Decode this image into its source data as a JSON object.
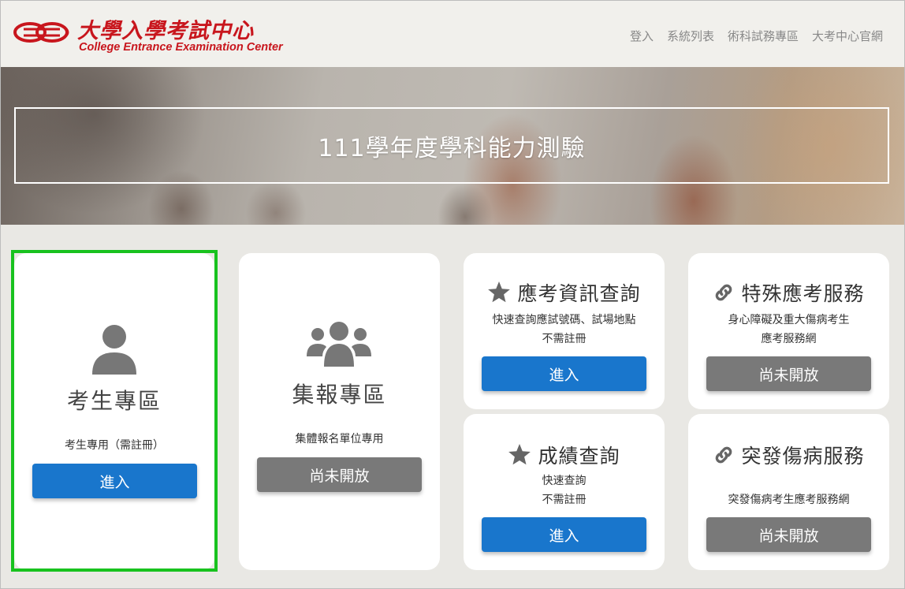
{
  "header": {
    "logo_cn": "大學入學考試中心",
    "logo_en": "College Entrance Examination Center",
    "nav": [
      "登入",
      "系統列表",
      "術科試務專區",
      "大考中心官網"
    ]
  },
  "banner": {
    "title": "111學年度學科能力測驗"
  },
  "cards": {
    "student": {
      "title": "考生專區",
      "desc": "考生專用（需註冊）",
      "button": "進入",
      "icon": "user-icon"
    },
    "group": {
      "title": "集報專區",
      "desc": "集體報名單位專用",
      "button": "尚未開放",
      "icon": "users-icon"
    },
    "exam_info": {
      "title": "應考資訊查詢",
      "desc1": "快速查詢應試號碼、試場地點",
      "desc2": "不需註冊",
      "button": "進入",
      "icon": "star-icon"
    },
    "special": {
      "title": "特殊應考服務",
      "desc1": "身心障礙及重大傷病考生",
      "desc2": "應考服務網",
      "button": "尚未開放",
      "icon": "link-icon"
    },
    "score": {
      "title": "成績查詢",
      "desc1": "快速查詢",
      "desc2": "不需註冊",
      "button": "進入",
      "icon": "star-icon"
    },
    "sudden": {
      "title": "突發傷病服務",
      "desc1": "突發傷病考生應考服務網",
      "button": "尚未開放",
      "icon": "link-icon"
    }
  },
  "colors": {
    "brand_red": "#c8161d",
    "button_blue": "#1976cc",
    "button_gray": "#797979",
    "highlight_green": "#18c21e"
  }
}
